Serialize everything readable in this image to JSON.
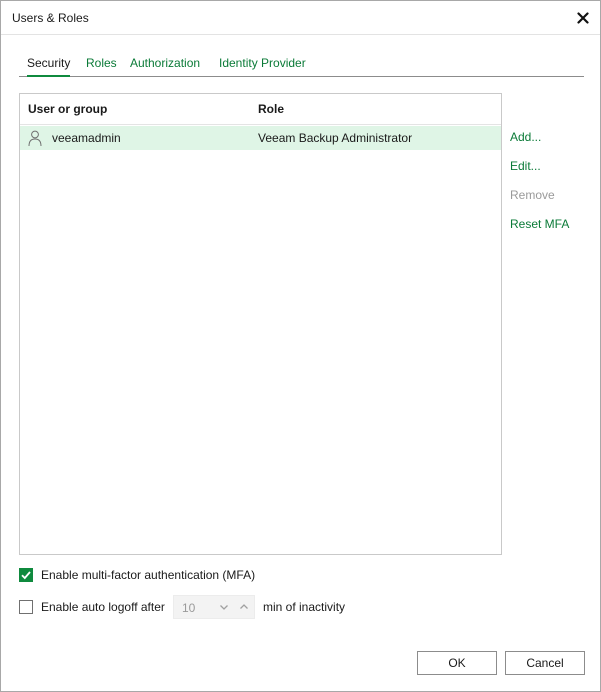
{
  "window": {
    "title": "Users & Roles"
  },
  "tabs": [
    {
      "label": "Security",
      "active": true
    },
    {
      "label": "Roles"
    },
    {
      "label": "Authorization"
    },
    {
      "label": "Identity Provider"
    }
  ],
  "grid": {
    "columns": [
      "User or group",
      "Role"
    ],
    "rows": [
      {
        "user": "veeamadmin",
        "role": "Veeam Backup Administrator",
        "selected": true
      }
    ]
  },
  "actions": {
    "add": "Add...",
    "edit": "Edit...",
    "remove": "Remove",
    "reset_mfa": "Reset MFA"
  },
  "options": {
    "mfa_label": "Enable multi-factor authentication (MFA)",
    "mfa_checked": true,
    "autologoff_label": "Enable auto logoff after",
    "autologoff_checked": false,
    "autologoff_value": "10",
    "autologoff_suffix": "min of inactivity"
  },
  "buttons": {
    "ok": "OK",
    "cancel": "Cancel"
  },
  "colors": {
    "accent": "#0f8a3e",
    "link": "#0a7a37",
    "selection": "#dff5e6"
  }
}
